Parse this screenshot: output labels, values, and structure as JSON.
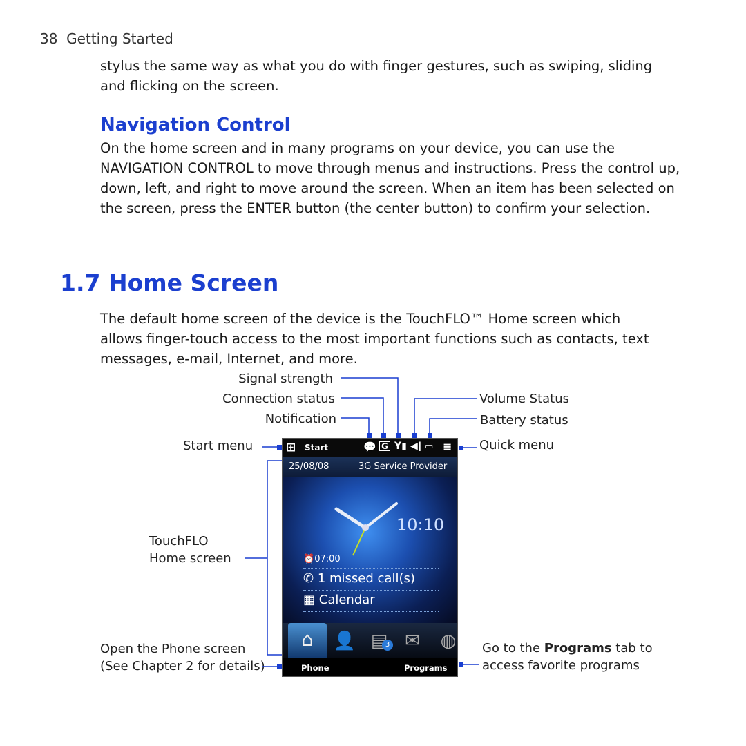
{
  "header": {
    "page_number": "38",
    "section": "Getting Started"
  },
  "intro_text": "stylus the same way as what you do with finger gestures, such as swiping, sliding and flicking on the screen.",
  "navigation_control": {
    "heading": "Navigation Control",
    "body": "On the home screen and in many programs on your device, you can use the NAVIGATION CONTROL to move through menus and instructions. Press the control up, down, left, and right to move around the screen. When an item has been selected on the screen, press the ENTER button (the center button) to confirm your selection."
  },
  "home_screen": {
    "number": "1.7",
    "heading": "Home Screen",
    "body": "The default home screen of the device is the TouchFLO™ Home screen which allows finger-touch access to the most important functions such as contacts, text messages, e-mail, Internet, and more."
  },
  "callouts": {
    "signal_strength": "Signal strength",
    "connection_status": "Connection status",
    "notification": "Notification",
    "start_menu": "Start menu",
    "volume_status": "Volume Status",
    "battery_status": "Battery status",
    "quick_menu": "Quick menu",
    "touchflo_line1": "TouchFLO",
    "touchflo_line2": "Home screen",
    "open_phone_line1": "Open the Phone screen",
    "open_phone_line2": "(See Chapter 2 for details)",
    "programs_pre": "Go to the ",
    "programs_bold": "Programs",
    "programs_post": " tab to",
    "programs_line2": "access favorite programs"
  },
  "phone": {
    "start_label": "Start",
    "date": "25/08/08",
    "provider": "3G Service Provider",
    "time": "10:10",
    "alarm": "07:00",
    "missed_calls": "1 missed call(s)",
    "calendar": "Calendar",
    "message_badge": "3",
    "left_softkey": "Phone",
    "right_softkey": "Programs",
    "status_icons": [
      "notification-icon",
      "connection-icon",
      "signal-icon",
      "volume-icon",
      "battery-icon",
      "quick-menu-icon"
    ],
    "tabs": [
      "home-icon",
      "people-icon",
      "messages-icon",
      "mail-icon",
      "internet-icon"
    ]
  },
  "colors": {
    "heading": "#1b3fcf",
    "callout_line": "#1a3fd1"
  }
}
